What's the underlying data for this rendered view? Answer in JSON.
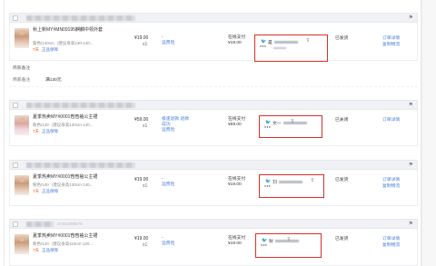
{
  "orders": [
    {
      "title": "秋上新MY#MN09195麒麟中领外套",
      "spec": "紫色/140cm（建议身高130-140...",
      "badge_day": "7天",
      "badge_text": "正品保障",
      "price": "¥19.00",
      "qty": "x1",
      "service": "-",
      "service_link": "运费险",
      "pay_method": "在线支付",
      "pay_amount": "¥19.00",
      "buyer_name": "是",
      "buyer_dots": "***",
      "status": "已发货",
      "ops": [
        "订单详情",
        "复制物流"
      ]
    },
    {
      "title": "夏季热卖MY#0001苞苞袖公主裙",
      "spec": "粉色/140（建议身高130cm-140...",
      "badge_day": "7天",
      "badge_text": "正品保障",
      "price": "¥59.00",
      "qty": "x1",
      "service": "",
      "service_link": "",
      "service_lines": [
        "极速退款 退款",
        "成功"
      ],
      "service_link2": "运费险",
      "pay_method": "在线支付",
      "pay_amount": "¥59.00",
      "buyer_name": "文一",
      "buyer_dots": "***",
      "status": "已关闭",
      "ops": [
        "订单详情"
      ]
    },
    {
      "title": "夏季热卖MY#0001苞苞袖公主裙",
      "spec": "粉色/140（建议身高130cm-140...",
      "badge_day": "7天",
      "badge_text": "正品保障",
      "price": "¥19.00",
      "qty": "x1",
      "service": "-",
      "service_link": "运费险",
      "pay_method": "在线支付",
      "pay_amount": "¥19.00",
      "buyer_name": "刘",
      "buyer_dots": "***",
      "status": "已发货",
      "ops": [
        "订单详情",
        "复制物流"
      ]
    },
    {
      "title": "夏季热卖MY#0001苞苞袖公主裙",
      "spec": "粉色/120（建议身高110cm-120...",
      "badge_day": "7天",
      "badge_text": "正品保障",
      "price": "¥19.00",
      "qty": "x1",
      "service": "-",
      "service_link": "运费险",
      "pay_method": "在线支付",
      "pay_amount": "¥19.00",
      "buyer_name": "秋",
      "buyer_dots": "***",
      "status": "已发货",
      "ops": [
        "订单详情",
        "复制物流"
      ]
    }
  ],
  "note": {
    "label": "商家备注",
    "value": "满130元"
  },
  "header_ids": {
    "order4_partial": "37251599679"
  },
  "colors": {
    "link": "#4a7ed6",
    "highlight_border": "#d93025",
    "header_bg": "#f0f2f5"
  },
  "icons": {
    "buyer": "wangwang-icon",
    "chat": "chat-icon",
    "flag": "flag-icon"
  }
}
